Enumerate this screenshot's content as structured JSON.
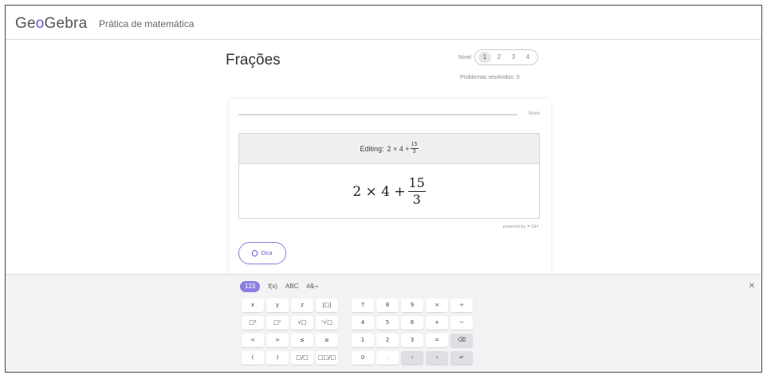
{
  "header": {
    "logo_pre": "Ge",
    "logo_o": "o",
    "logo_post": "Gebra",
    "subtitle": "Prática de matemática"
  },
  "page": {
    "title": "Frações",
    "level_label": "Nível",
    "levels": [
      "1",
      "2",
      "3",
      "4"
    ],
    "active_level": "1",
    "solved_label": "Problemas resolvidos: 0"
  },
  "card": {
    "progress_fraction": 0,
    "next_label": "Novo",
    "editing_label": "Editing:",
    "expression": {
      "lhs": "2 × 4 +",
      "numerator": "15",
      "denominator": "3"
    },
    "powered_by": "powered by ✕ GH",
    "hint_label": "Dica"
  },
  "keyboard": {
    "tabs": [
      "123",
      "f(x)",
      "ABC",
      "#&¬"
    ],
    "active_tab": "123",
    "close_icon": "close-icon",
    "rows": [
      [
        "x",
        "y",
        "z",
        "|□|",
        "7",
        "8",
        "9",
        "×",
        "÷"
      ],
      [
        "□²",
        "□ⁿ",
        "√□",
        "ⁿ√□",
        "4",
        "5",
        "6",
        "+",
        "−"
      ],
      [
        "<",
        ">",
        "≤",
        "≥",
        "1",
        "2",
        "3",
        "=",
        "⌫"
      ],
      [
        "(",
        ")",
        "□/□",
        "□□/□",
        "0",
        ".",
        "‹",
        "›",
        "↵"
      ]
    ]
  },
  "colors": {
    "accent": "#6557d2",
    "accent_light": "#8a7fe0"
  }
}
